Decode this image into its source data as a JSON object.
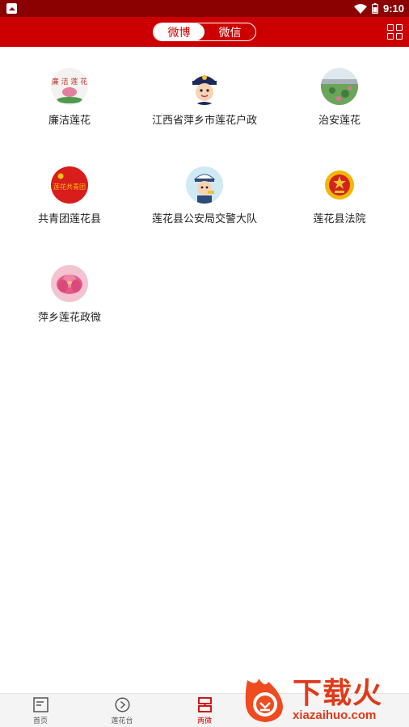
{
  "status_bar": {
    "time": "9:10"
  },
  "header": {
    "tabs": [
      {
        "label": "微博",
        "active": true
      },
      {
        "label": "微信",
        "active": false
      }
    ]
  },
  "accounts": [
    {
      "label": "廉洁莲花",
      "icon": "lotus-logo-avatar"
    },
    {
      "label": "江西省萍乡市莲花户政",
      "icon": "police-cartoon-avatar"
    },
    {
      "label": "治安莲花",
      "icon": "lotus-pond-avatar"
    },
    {
      "label": "共青团莲花县",
      "icon": "youth-league-avatar"
    },
    {
      "label": "莲花县公安局交警大队",
      "icon": "traffic-police-avatar"
    },
    {
      "label": "莲花县法院",
      "icon": "court-emblem-avatar"
    },
    {
      "label": "萍乡莲花政微",
      "icon": "pink-lotus-avatar"
    }
  ],
  "tabbar": {
    "items": [
      {
        "label": "首页",
        "icon": "home-doc-icon",
        "active": false
      },
      {
        "label": "莲花台",
        "icon": "play-circle-icon",
        "active": false
      },
      {
        "label": "两微",
        "icon": "two-micro-icon",
        "active": true
      }
    ]
  },
  "watermark": {
    "cn": "下载火",
    "en": "xiazaihuo.com"
  },
  "colors": {
    "brand_red": "#cc0000",
    "status_dark_red": "#8b0000"
  }
}
